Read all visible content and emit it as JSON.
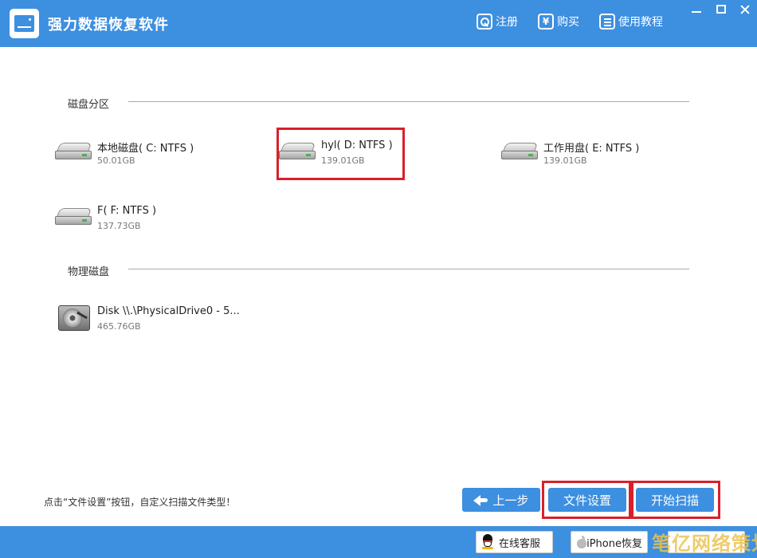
{
  "app": {
    "title": "强力数据恢复软件"
  },
  "toolbar": {
    "register_label": "注册",
    "buy_label": "购买",
    "buy_icon_glyph": "¥",
    "tutorial_label": "使用教程"
  },
  "icons": {
    "register": "key-icon",
    "buy": "yen-icon",
    "tutorial": "document-icon",
    "partition": "disk-drive-icon",
    "physical": "hard-disk-icon",
    "back": "back-arrow-icon",
    "service": "qq-penguin-icon",
    "iphone": "apple-icon"
  },
  "sections": {
    "partitions_label": "磁盘分区",
    "physical_label": "物理磁盘"
  },
  "partitions": [
    {
      "name": "本地磁盘( C: NTFS )",
      "size": "50.01GB"
    },
    {
      "name": "hyl( D: NTFS )",
      "size": "139.01GB"
    },
    {
      "name": "工作用盘( E: NTFS )",
      "size": "139.01GB"
    },
    {
      "name": "F( F: NTFS )",
      "size": "137.73GB"
    }
  ],
  "physical_disks": [
    {
      "name": "Disk \\\\.\\PhysicalDrive0 - 5...",
      "size": "465.76GB"
    }
  ],
  "hint": "点击“文件设置”按钮，自定义扫描文件类型！",
  "actions": {
    "prev_label": "上一步",
    "file_settings_label": "文件设置",
    "start_scan_label": "开始扫描"
  },
  "footer": {
    "service_label": "在线客服",
    "iphone_label": "iPhone恢复"
  },
  "watermark": "笔亿网络策划",
  "colors": {
    "accent": "#3d8fe0",
    "highlight": "#d9202a"
  }
}
